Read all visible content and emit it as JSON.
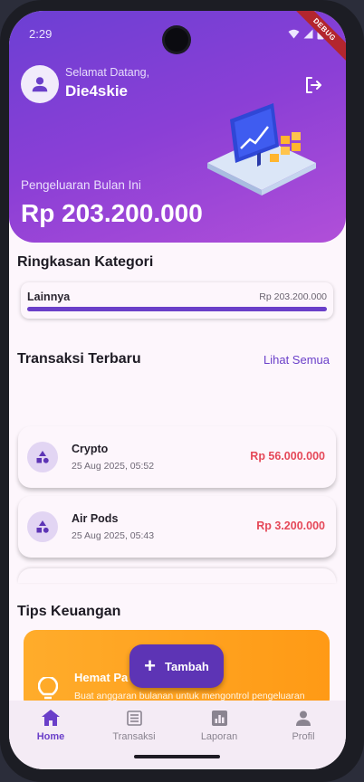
{
  "status_bar": {
    "time": "2:29",
    "debug_badge": "DEBUG"
  },
  "header": {
    "greeting": "Selamat Datang,",
    "username": "Die4skie",
    "spending_label": "Pengeluaran Bulan Ini",
    "spending_amount": "Rp 203.200.000"
  },
  "category_summary": {
    "title": "Ringkasan Kategori",
    "items": [
      {
        "name": "Lainnya",
        "amount": "Rp 203.200.000",
        "progress": 1.0
      }
    ]
  },
  "recent_transactions": {
    "title": "Transaksi Terbaru",
    "see_all_label": "Lihat Semua",
    "items": [
      {
        "name": "Crypto",
        "date": "25 Aug 2025, 05:52",
        "amount": "Rp 56.000.000"
      },
      {
        "name": "Air Pods",
        "date": "25 Aug 2025, 05:43",
        "amount": "Rp 3.200.000"
      }
    ]
  },
  "tips": {
    "title": "Tips Keuangan",
    "card_title": "Hemat Pa",
    "card_text": "Buat anggaran bulanan untuk mengontrol pengeluaran"
  },
  "fab": {
    "label": "Tambah"
  },
  "bottom_nav": {
    "items": [
      {
        "label": "Home",
        "icon": "home-icon",
        "active": true
      },
      {
        "label": "Transaksi",
        "icon": "list-icon",
        "active": false
      },
      {
        "label": "Laporan",
        "icon": "chart-icon",
        "active": false
      },
      {
        "label": "Profil",
        "icon": "person-icon",
        "active": false
      }
    ]
  },
  "colors": {
    "primary": "#6a3fc9",
    "expense": "#e54858",
    "tip_card": "#ff9a15"
  }
}
